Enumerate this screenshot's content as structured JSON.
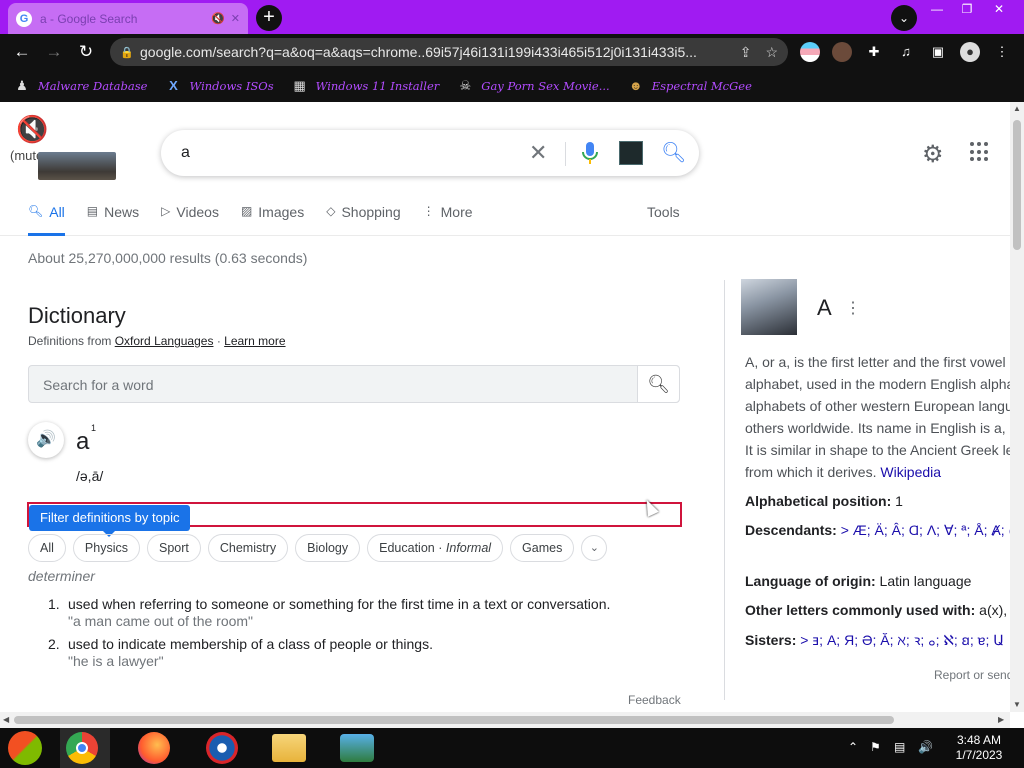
{
  "browser": {
    "tab_title": "a - Google Search",
    "url": "google.com/search?q=a&oq=a&aqs=chrome..69i57j46i131i199i433i465i512j0i131i433i5...",
    "bookmarks": [
      {
        "label": "Malware Database",
        "icon": "person-icon"
      },
      {
        "label": "Windows ISOs",
        "icon": "x-icon"
      },
      {
        "label": "Windows 11 Installer",
        "icon": "image-icon"
      },
      {
        "label": "Gay Porn Sex Movie...",
        "icon": "skull-icon"
      },
      {
        "label": "Espectral McGee",
        "icon": "mask-icon"
      }
    ],
    "colors": {
      "titlebar": "#a01bf2",
      "bookmark_text": "#b34cff"
    }
  },
  "doodle": {
    "mute_label": "(mute"
  },
  "search": {
    "query": "a"
  },
  "navtabs": [
    {
      "label": "All",
      "icon": "search-icon",
      "active": true
    },
    {
      "label": "News",
      "icon": "news-icon"
    },
    {
      "label": "Videos",
      "icon": "video-icon"
    },
    {
      "label": "Images",
      "icon": "image-icon"
    },
    {
      "label": "Shopping",
      "icon": "tag-icon"
    },
    {
      "label": "More",
      "icon": "kebab-icon"
    }
  ],
  "tools_label": "Tools",
  "stats": "About 25,270,000,000 results (0.63 seconds)",
  "dictionary": {
    "title": "Dictionary",
    "source_prefix": "Definitions from",
    "source_link": "Oxford Languages",
    "separator": "·",
    "learn_more": "Learn more",
    "search_placeholder": "Search for a word",
    "headword": "a",
    "superscript": "1",
    "phonetic": "/ə,ā/",
    "tooltip": "Filter definitions by topic",
    "chips": [
      "All",
      "Physics",
      "Sport",
      "Chemistry",
      "Biology",
      "Education",
      "Games"
    ],
    "chip_education_suffix": "Informal",
    "chip_sep": "·",
    "part_of_speech": "determiner",
    "senses": [
      {
        "num": "1.",
        "def": "used when referring to someone or something for the first time in a text or conversation.",
        "example": "\"a man came out of the room\""
      },
      {
        "num": "2.",
        "def": "used to indicate membership of a class of people or things.",
        "example": "\"he is a lawyer\""
      }
    ],
    "feedback": "Feedback"
  },
  "knowledge_panel": {
    "title": "A",
    "desc_lines": [
      "A, or a, is the first letter and the first vowel of",
      "alphabet, used in the modern English alphabet,",
      "alphabets of other western European languages",
      "others worldwide. Its name in English is a,",
      "It is similar in shape to the Ancient Greek letter",
      "from which it derives."
    ],
    "wiki_link": "Wikipedia",
    "facts": [
      {
        "label": "Alphabetical position:",
        "value": "1"
      },
      {
        "label": "Descendants:",
        "value": "> Æ; Ä; Â; Ɑ; Ʌ; ∀; ª; Å; Ⱥ; @; ("
      },
      {
        "label": "Language of origin:",
        "value": "Latin language"
      },
      {
        "label": "Other letters commonly used with:",
        "value": "a(x), ae"
      },
      {
        "label": "Sisters:",
        "value": "> ⱻ; А; Я; Ə; Ă; ℵ; ꝛ; ࡀ; ℵ; ꞛ; ɐ; Ա"
      }
    ],
    "report": "Report or send"
  },
  "taskbar": {
    "time": "3:48 AM",
    "date": "1/7/2023"
  }
}
